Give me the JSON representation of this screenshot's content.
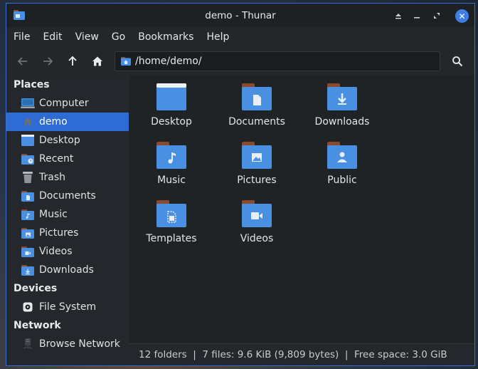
{
  "window": {
    "title": "demo - Thunar"
  },
  "menubar": [
    "File",
    "Edit",
    "View",
    "Go",
    "Bookmarks",
    "Help"
  ],
  "location": {
    "path": "/home/demo/"
  },
  "sidebar": {
    "places_header": "Places",
    "places": [
      {
        "label": "Computer",
        "icon": "computer-icon"
      },
      {
        "label": "demo",
        "icon": "home-icon",
        "active": true
      },
      {
        "label": "Desktop",
        "icon": "desktop-folder-icon"
      },
      {
        "label": "Recent",
        "icon": "recent-folder-icon"
      },
      {
        "label": "Trash",
        "icon": "trash-icon"
      },
      {
        "label": "Documents",
        "icon": "documents-folder-icon"
      },
      {
        "label": "Music",
        "icon": "music-folder-icon"
      },
      {
        "label": "Pictures",
        "icon": "pictures-folder-icon"
      },
      {
        "label": "Videos",
        "icon": "videos-folder-icon"
      },
      {
        "label": "Downloads",
        "icon": "downloads-folder-icon"
      }
    ],
    "devices_header": "Devices",
    "devices": [
      {
        "label": "File System",
        "icon": "drive-icon"
      }
    ],
    "network_header": "Network",
    "network": [
      {
        "label": "Browse Network",
        "icon": "network-icon"
      }
    ]
  },
  "files": [
    {
      "label": "Desktop",
      "icon": "desktop-folder-icon"
    },
    {
      "label": "Documents",
      "icon": "documents-folder-icon"
    },
    {
      "label": "Downloads",
      "icon": "downloads-folder-icon"
    },
    {
      "label": "Music",
      "icon": "music-folder-icon"
    },
    {
      "label": "Pictures",
      "icon": "pictures-folder-icon"
    },
    {
      "label": "Public",
      "icon": "public-folder-icon"
    },
    {
      "label": "Templates",
      "icon": "templates-folder-icon"
    },
    {
      "label": "Videos",
      "icon": "videos-folder-icon"
    }
  ],
  "status": {
    "text": "12 folders  |  7 files: 9.6 KiB (9,809 bytes)  |  Free space: 3.0 GiB"
  },
  "colors": {
    "accent": "#2f6bd4",
    "folder": "#4a90e2",
    "folder_tab": "#8b4a2b"
  }
}
